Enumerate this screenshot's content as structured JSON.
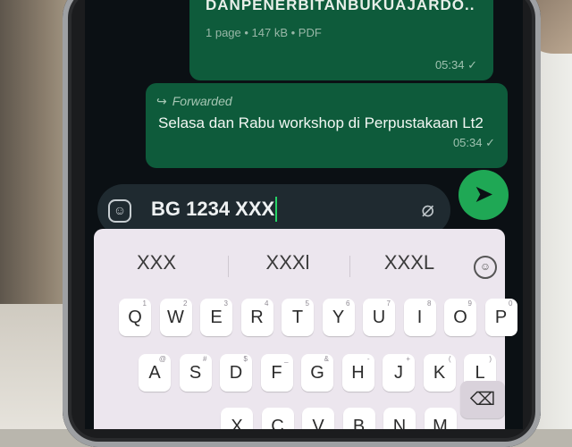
{
  "chat": {
    "document": {
      "title": "DANPENERBITANBUKUAJARDO...",
      "meta": "1 page • 147 kB • PDF",
      "time": "05:34 ✓"
    },
    "forwarded": {
      "label": "Forwarded",
      "text": "Selasa dan Rabu workshop di Perpustakaan Lt2",
      "time": "05:34 ✓"
    }
  },
  "composer": {
    "value": "BG 1234 XXX",
    "emoji_icon": "sticker-icon",
    "attach_icon": "paperclip-icon",
    "send_icon": "send-icon"
  },
  "keyboard": {
    "suggestions": [
      "XXX",
      "XXXl",
      "XXXL"
    ],
    "row1": [
      {
        "k": "Q",
        "s": "1"
      },
      {
        "k": "W",
        "s": "2"
      },
      {
        "k": "E",
        "s": "3"
      },
      {
        "k": "R",
        "s": "4"
      },
      {
        "k": "T",
        "s": "5"
      },
      {
        "k": "Y",
        "s": "6"
      },
      {
        "k": "U",
        "s": "7"
      },
      {
        "k": "I",
        "s": "8"
      },
      {
        "k": "O",
        "s": "9"
      },
      {
        "k": "P",
        "s": "0"
      }
    ],
    "row2": [
      {
        "k": "A",
        "s": "@"
      },
      {
        "k": "S",
        "s": "#"
      },
      {
        "k": "D",
        "s": "$"
      },
      {
        "k": "F",
        "s": "_"
      },
      {
        "k": "G",
        "s": "&"
      },
      {
        "k": "H",
        "s": "-"
      },
      {
        "k": "J",
        "s": "+"
      },
      {
        "k": "K",
        "s": "("
      },
      {
        "k": "L",
        "s": ")"
      }
    ],
    "row3": [
      {
        "k": "X",
        "s": ""
      },
      {
        "k": "C",
        "s": ""
      },
      {
        "k": "V",
        "s": ""
      },
      {
        "k": "B",
        "s": ""
      },
      {
        "k": "N",
        "s": ""
      },
      {
        "k": "M",
        "s": ""
      }
    ],
    "backspace": "⌫"
  }
}
